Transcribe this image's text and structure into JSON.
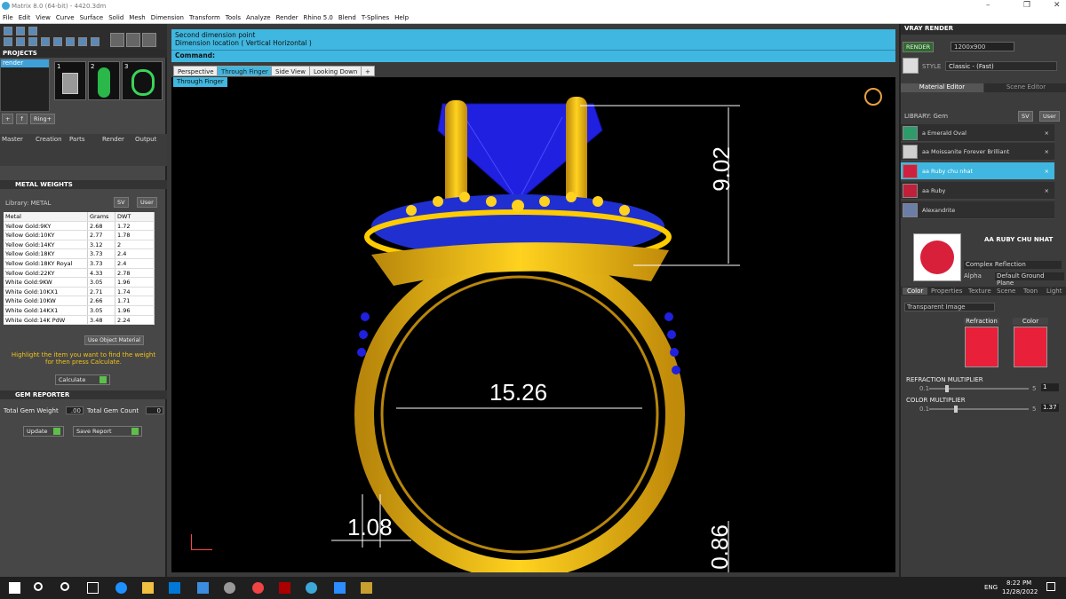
{
  "window": {
    "title": "Matrix 8.0 (64-bit) - 4420.3dm"
  },
  "menu": [
    "File",
    "Edit",
    "View",
    "Curve",
    "Surface",
    "Solid",
    "Mesh",
    "Dimension",
    "Transform",
    "Tools",
    "Analyze",
    "Render",
    "Rhino 5.0",
    "Blend",
    "T-Splines",
    "Help"
  ],
  "projects": {
    "header": "PROJECTS",
    "item": "render",
    "thumbs": [
      "1",
      "2",
      "3"
    ],
    "ring_btn": "Ring+",
    "panels": [
      "Master",
      "Creation",
      "Parts",
      "Render",
      "Output"
    ]
  },
  "metal": {
    "header": "METAL WEIGHTS",
    "library_label": "Library: METAL",
    "sv": "SV",
    "user": "User",
    "columns": [
      "Metal",
      "Grams",
      "DWT"
    ],
    "rows": [
      [
        "Yellow Gold:9KY",
        "2.68",
        "1.72"
      ],
      [
        "Yellow Gold:10KY",
        "2.77",
        "1.78"
      ],
      [
        "Yellow Gold:14KY",
        "3.12",
        "2"
      ],
      [
        "Yellow Gold:18KY",
        "3.73",
        "2.4"
      ],
      [
        "Yellow Gold:18KY Royal",
        "3.73",
        "2.4"
      ],
      [
        "Yellow Gold:22KY",
        "4.33",
        "2.78"
      ],
      [
        "White Gold:9KW",
        "3.05",
        "1.96"
      ],
      [
        "White Gold:10KX1",
        "2.71",
        "1.74"
      ],
      [
        "White Gold:10KW",
        "2.66",
        "1.71"
      ],
      [
        "White Gold:14KX1",
        "3.05",
        "1.96"
      ],
      [
        "White Gold:14K PdW",
        "3.48",
        "2.24"
      ]
    ],
    "use_object": "Use Object Material",
    "hint": "Highlight the item you want to find the weight for then press Calculate.",
    "calculate": "Calculate"
  },
  "gem": {
    "header": "GEM REPORTER",
    "total_weight_label": "Total Gem Weight",
    "total_weight": ".00",
    "total_count_label": "Total Gem Count",
    "total_count": "0",
    "update": "Update",
    "save_report": "Save Report"
  },
  "command": {
    "line1": "Second dimension point",
    "line2": "Dimension location ( Vertical  Horizontal )",
    "prompt": "Command:"
  },
  "tabs": [
    "Perspective",
    "Through Finger",
    "Side View",
    "Looking Down"
  ],
  "active_view": "Through Finger",
  "dims": {
    "top": "9.02",
    "width": "15.26",
    "thick": "1.08",
    "bottom": "0.86"
  },
  "vray": {
    "title": "VRAY RENDER",
    "render": "RENDER",
    "resolution": "1200x900",
    "style_label": "STYLE",
    "style": "Classic - (Fast)",
    "tabs": [
      "Material Editor",
      "Scene Editor"
    ],
    "library": "LIBRARY: Gem",
    "sv": "SV",
    "user": "User",
    "items": [
      {
        "name": "a Emerald Oval",
        "color": "#2e9b6a"
      },
      {
        "name": "aa Moissanite Forever Brilliant",
        "color": "#cfcfcf"
      },
      {
        "name": "aa Ruby chu nhat",
        "color": "#d02040"
      },
      {
        "name": "aa Ruby",
        "color": "#c0203a"
      },
      {
        "name": "Alexandrite",
        "color": "#6a7ea8"
      }
    ],
    "selected": "AA RUBY CHU NHAT",
    "complex": "Complex Reflection",
    "alpha": "Alpha",
    "ground": "Default Ground Plane",
    "subtabs": [
      "Color",
      "Properties",
      "Texture",
      "Scene",
      "Toon",
      "Light"
    ],
    "transparent": "Transparent Image",
    "refraction": "Refraction",
    "color": "Color",
    "refr_mult": "REFRACTION MULTIPLIER",
    "refr_min": "0.1",
    "refr_max": "5",
    "refr_val": "1",
    "color_mult": "COLOR MULTIPLIER",
    "col_min": "0.1",
    "col_max": "5",
    "col_val": "1.37"
  },
  "taskbar": {
    "lang": "ENG",
    "time": "8:22 PM",
    "date": "12/28/2022"
  }
}
